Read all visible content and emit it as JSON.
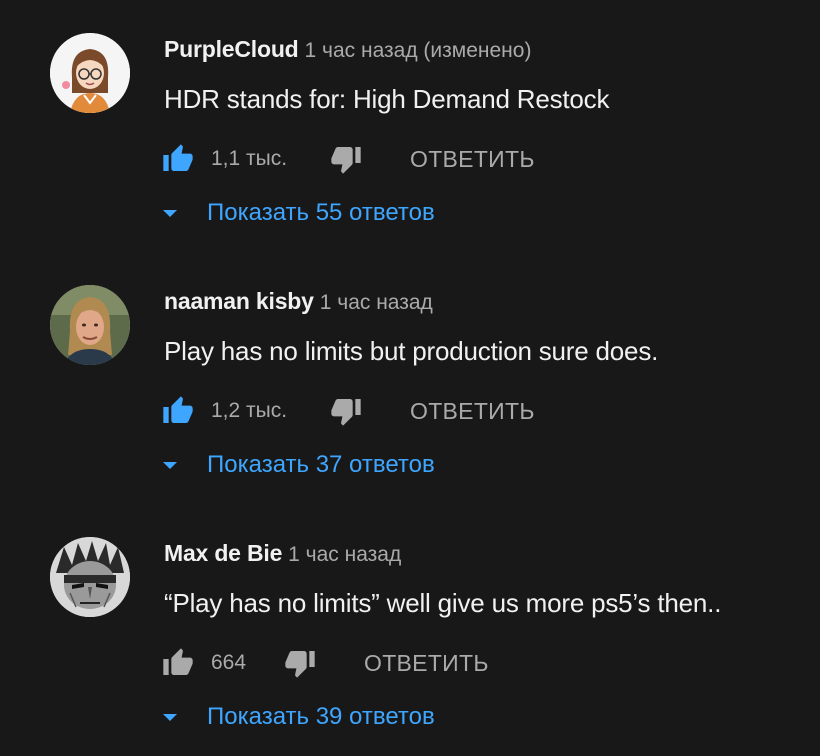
{
  "colors": {
    "background": "#181818",
    "text": "#f1f1f1",
    "muted": "#aaaaaa",
    "accent": "#3ea6ff"
  },
  "comments": [
    {
      "author": "PurpleCloud",
      "time": "1 час назад (изменено)",
      "text": "HDR stands for: High Demand Restock",
      "likes": "1,1 тыс.",
      "liked": true,
      "reply_label": "ОТВЕТИТЬ",
      "replies_label": "Показать 55 ответов",
      "avatar_icon": "cartoon-girl-avatar"
    },
    {
      "author": "naaman kisby",
      "time": "1 час назад",
      "text": "Play has no limits but production sure does.",
      "likes": "1,2 тыс.",
      "liked": true,
      "reply_label": "ОТВЕТИТЬ",
      "replies_label": "Показать 37 ответов",
      "avatar_icon": "man-photo-avatar"
    },
    {
      "author": "Max de Bie",
      "time": "1 час назад",
      "text": "“Play has no limits” well give us more ps5’s then..",
      "likes": "664",
      "liked": false,
      "reply_label": "ОТВЕТИТЬ",
      "replies_label": "Показать 39 ответов",
      "avatar_icon": "anime-character-avatar"
    }
  ]
}
